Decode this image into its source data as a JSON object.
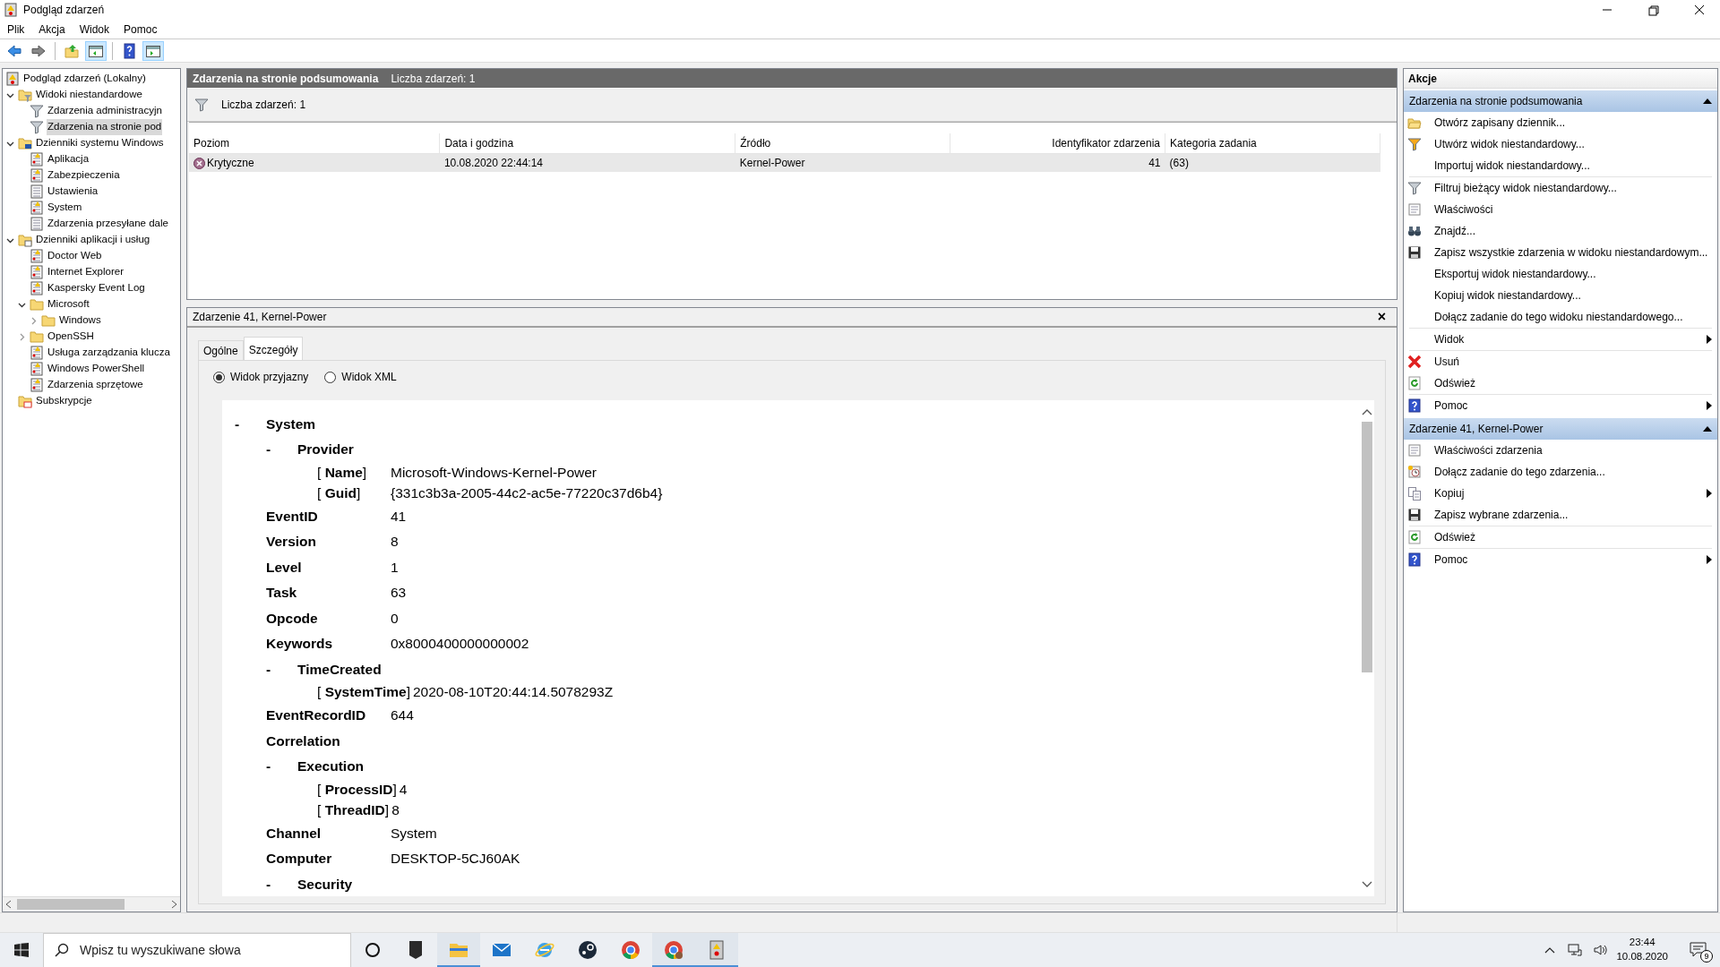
{
  "window": {
    "title": "Podgląd zdarzeń"
  },
  "menu": [
    "Plik",
    "Akcja",
    "Widok",
    "Pomoc"
  ],
  "toolbar": [
    {
      "kind": "back",
      "pressed": false
    },
    {
      "kind": "forward",
      "pressed": false
    },
    {
      "kind": "up",
      "pressed": false
    },
    {
      "kind": "tree",
      "pressed": true
    },
    {
      "kind": "help",
      "pressed": false
    },
    {
      "kind": "actions",
      "pressed": true
    }
  ],
  "tree": [
    {
      "label": "Podgląd zdarzeń (Lokalny)",
      "kind": "root",
      "selected": false
    },
    {
      "label": "Widoki niestandardowe",
      "kind": "filterfolder",
      "expanded": true,
      "selected": false,
      "children": [
        {
          "label": "Zdarzenia administracyjn",
          "kind": "filter",
          "selected": false
        },
        {
          "label": "Zdarzenia na stronie pod",
          "kind": "filter",
          "selected": true
        }
      ]
    },
    {
      "label": "Dzienniki systemu Windows",
      "kind": "pcfolder",
      "expanded": true,
      "selected": false,
      "children": [
        {
          "label": "Aplikacja",
          "kind": "log",
          "selected": false
        },
        {
          "label": "Zabezpieczenia",
          "kind": "log",
          "selected": false
        },
        {
          "label": "Ustawienia",
          "kind": "plainlog",
          "selected": false
        },
        {
          "label": "System",
          "kind": "log",
          "selected": false
        },
        {
          "label": "Zdarzenia przesyłane dale",
          "kind": "plainlog",
          "selected": false
        }
      ]
    },
    {
      "label": "Dzienniki aplikacji i usług",
      "kind": "appfolder",
      "expanded": true,
      "selected": false,
      "children": [
        {
          "label": "Doctor Web",
          "kind": "log",
          "selected": false
        },
        {
          "label": "Internet Explorer",
          "kind": "log",
          "selected": false
        },
        {
          "label": "Kaspersky Event Log",
          "kind": "log",
          "selected": false
        },
        {
          "label": "Microsoft",
          "kind": "folder",
          "expanded": true,
          "selected": false,
          "children": [
            {
              "label": "Windows",
              "kind": "folder",
              "expanded": false,
              "selected": false
            }
          ]
        },
        {
          "label": "OpenSSH",
          "kind": "folder",
          "expanded": false,
          "selected": false
        },
        {
          "label": "Usługa zarządzania klucza",
          "kind": "log",
          "selected": false
        },
        {
          "label": "Windows PowerShell",
          "kind": "log",
          "selected": false
        },
        {
          "label": "Zdarzenia sprzętowe",
          "kind": "log",
          "selected": false
        }
      ]
    },
    {
      "label": "Subskrypcje",
      "kind": "subs",
      "selected": false
    }
  ],
  "list": {
    "title": "Zdarzenia na stronie podsumowania",
    "count": "Liczba zdarzeń: 1",
    "filter_text": "Liczba zdarzeń: 1",
    "columns": [
      {
        "label": "Poziom",
        "kind": "text"
      },
      {
        "label": "Data i godzina",
        "kind": "text"
      },
      {
        "label": "Źródło",
        "kind": "text"
      },
      {
        "label": "Identyfikator zdarzenia",
        "kind": "number"
      },
      {
        "label": "Kategoria zadania",
        "kind": "text"
      }
    ],
    "rows": [
      {
        "selected": true,
        "kind": "critical",
        "cells": [
          "Krytyczne",
          "10.08.2020 22:44:14",
          "Kernel-Power",
          "41",
          "(63)"
        ]
      }
    ]
  },
  "detail": {
    "title": "Zdarzenie 41, Kernel-Power",
    "close": "×",
    "tabs": [
      {
        "label": "Ogólne",
        "selected": false
      },
      {
        "label": "Szczegóły",
        "selected": true
      }
    ],
    "views": [
      {
        "label": "Widok przyjazny",
        "checked": true
      },
      {
        "label": "Widok XML",
        "checked": false
      }
    ],
    "nodes": [
      {
        "kind": "group",
        "toggle": "-",
        "name": "System",
        "children": [
          {
            "kind": "group",
            "toggle": "-",
            "name": "Provider",
            "children": [
              {
                "kind": "attr",
                "name": "[ **Name**]",
                "value": "Microsoft-Windows-Kernel-Power"
              },
              {
                "kind": "attr",
                "name": "[ **Guid**]",
                "value": "{331c3b3a-2005-44c2-ac5e-77220c37d6b4}"
              }
            ]
          },
          {
            "kind": "field",
            "name": "EventID",
            "value": "41"
          },
          {
            "kind": "field",
            "name": "Version",
            "value": "8"
          },
          {
            "kind": "field",
            "name": "Level",
            "value": "1"
          },
          {
            "kind": "field",
            "name": "Task",
            "value": "63"
          },
          {
            "kind": "field",
            "name": "Opcode",
            "value": "0"
          },
          {
            "kind": "field",
            "name": "Keywords",
            "value": "0x8000400000000002"
          },
          {
            "kind": "group",
            "toggle": "-",
            "name": "TimeCreated",
            "children": [
              {
                "kind": "attr",
                "name": "[ **SystemTime**]",
                "value": "2020-08-10T20:44:14.5078293Z"
              }
            ]
          },
          {
            "kind": "field",
            "name": "EventRecordID",
            "value": "644"
          },
          {
            "kind": "field",
            "name": "Correlation"
          },
          {
            "kind": "group",
            "toggle": "-",
            "name": "Execution",
            "children": [
              {
                "kind": "attr",
                "name": "[ **ProcessID**]",
                "value": "4"
              },
              {
                "kind": "attr",
                "name": "[ **ThreadID**]",
                "value": "8"
              }
            ]
          },
          {
            "kind": "field",
            "name": "Channel",
            "value": "System"
          },
          {
            "kind": "field",
            "name": "Computer",
            "value": "DESKTOP-5CJ60AK"
          },
          {
            "kind": "group",
            "toggle": "-",
            "name": "Security"
          }
        ]
      }
    ]
  },
  "actions": {
    "title": "Akcje",
    "sections": [
      {
        "title": "Zdarzenia na stronie podsumowania",
        "expanded": true,
        "items": [
          {
            "label": "Otwórz zapisany dziennik...",
            "kind": "open",
            "submenu": false,
            "divider_before": false
          },
          {
            "label": "Utwórz widok niestandardowy...",
            "kind": "newfilter",
            "submenu": false,
            "divider_before": false
          },
          {
            "label": "Importuj widok niestandardowy...",
            "kind": "plain",
            "submenu": false,
            "divider_before": false
          },
          {
            "label": "Filtruj bieżący widok niestandardowy...",
            "kind": "filter",
            "submenu": false,
            "divider_before": true
          },
          {
            "label": "Właściwości",
            "kind": "props",
            "submenu": false,
            "divider_before": false
          },
          {
            "label": "Znajdź...",
            "kind": "find",
            "submenu": false,
            "divider_before": false
          },
          {
            "label": "Zapisz wszystkie zdarzenia w widoku niestandardowym...",
            "kind": "save",
            "submenu": false,
            "divider_before": false
          },
          {
            "label": "Eksportuj widok niestandardowy...",
            "kind": "plain",
            "submenu": false,
            "divider_before": false
          },
          {
            "label": "Kopiuj widok niestandardowy...",
            "kind": "plain",
            "submenu": false,
            "divider_before": false
          },
          {
            "label": "Dołącz zadanie do tego widoku niestandardowego...",
            "kind": "plain",
            "submenu": false,
            "divider_before": false
          },
          {
            "label": "Widok",
            "kind": "plain",
            "submenu": true,
            "divider_before": true
          },
          {
            "label": "Usuń",
            "kind": "delete",
            "submenu": false,
            "divider_before": true
          },
          {
            "label": "Odśwież",
            "kind": "refresh",
            "submenu": false,
            "divider_before": false
          },
          {
            "label": "Pomoc",
            "kind": "help",
            "submenu": true,
            "divider_before": true
          }
        ]
      },
      {
        "title": "Zdarzenie 41, Kernel-Power",
        "expanded": true,
        "items": [
          {
            "label": "Właściwości zdarzenia",
            "kind": "props",
            "submenu": false,
            "divider_before": false
          },
          {
            "label": "Dołącz zadanie do tego zdarzenia...",
            "kind": "task",
            "submenu": false,
            "divider_before": false
          },
          {
            "label": "Kopiuj",
            "kind": "copy",
            "submenu": true,
            "divider_before": false
          },
          {
            "label": "Zapisz wybrane zdarzenia...",
            "kind": "save",
            "submenu": false,
            "divider_before": false
          },
          {
            "label": "Odśwież",
            "kind": "refresh",
            "submenu": false,
            "divider_before": true
          },
          {
            "label": "Pomoc",
            "kind": "help",
            "submenu": true,
            "divider_before": true
          }
        ]
      }
    ]
  },
  "taskbar": {
    "search": {
      "placeholder": "Wpisz tu wyszukiwane słowa"
    },
    "apps": [
      {
        "kind": "cortana",
        "active": false
      },
      {
        "kind": "epic",
        "active": false
      },
      {
        "kind": "explorer",
        "active": true
      },
      {
        "kind": "mail",
        "active": false
      },
      {
        "kind": "ie",
        "active": false
      },
      {
        "kind": "steam",
        "active": false
      },
      {
        "kind": "chrome",
        "active": false
      },
      {
        "kind": "chromeuser",
        "active": true
      },
      {
        "kind": "eventviewer",
        "active": true
      }
    ],
    "time": "23:44",
    "date": "10.08.2020",
    "notifications": "9"
  }
}
